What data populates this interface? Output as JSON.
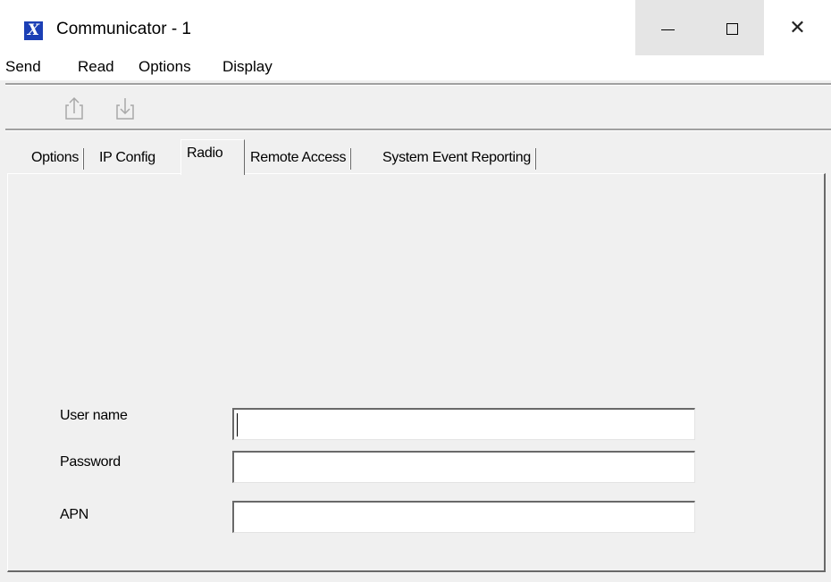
{
  "window": {
    "title": "Communicator - 1",
    "app_icon_letter": "X"
  },
  "controls": {
    "close_glyph": "✕"
  },
  "menu": [
    "Send",
    "Read",
    "Options",
    "Display"
  ],
  "toolbar": [
    {
      "icon": "upload-icon"
    },
    {
      "icon": "download-icon"
    }
  ],
  "tabs": [
    {
      "label": "Options",
      "active": false
    },
    {
      "label": "IP Config",
      "active": false
    },
    {
      "label": "Radio",
      "active": true
    },
    {
      "label": "Remote Access",
      "active": false
    },
    {
      "label": "System Event Reporting",
      "active": false
    }
  ],
  "form": {
    "username": {
      "label": "User name",
      "value": ""
    },
    "password": {
      "label": "Password",
      "value": ""
    },
    "apn": {
      "label": "APN",
      "value": ""
    }
  },
  "colors": {
    "app_icon_bg": "#1b3fb5",
    "panel_bg": "#f0f0f0"
  }
}
